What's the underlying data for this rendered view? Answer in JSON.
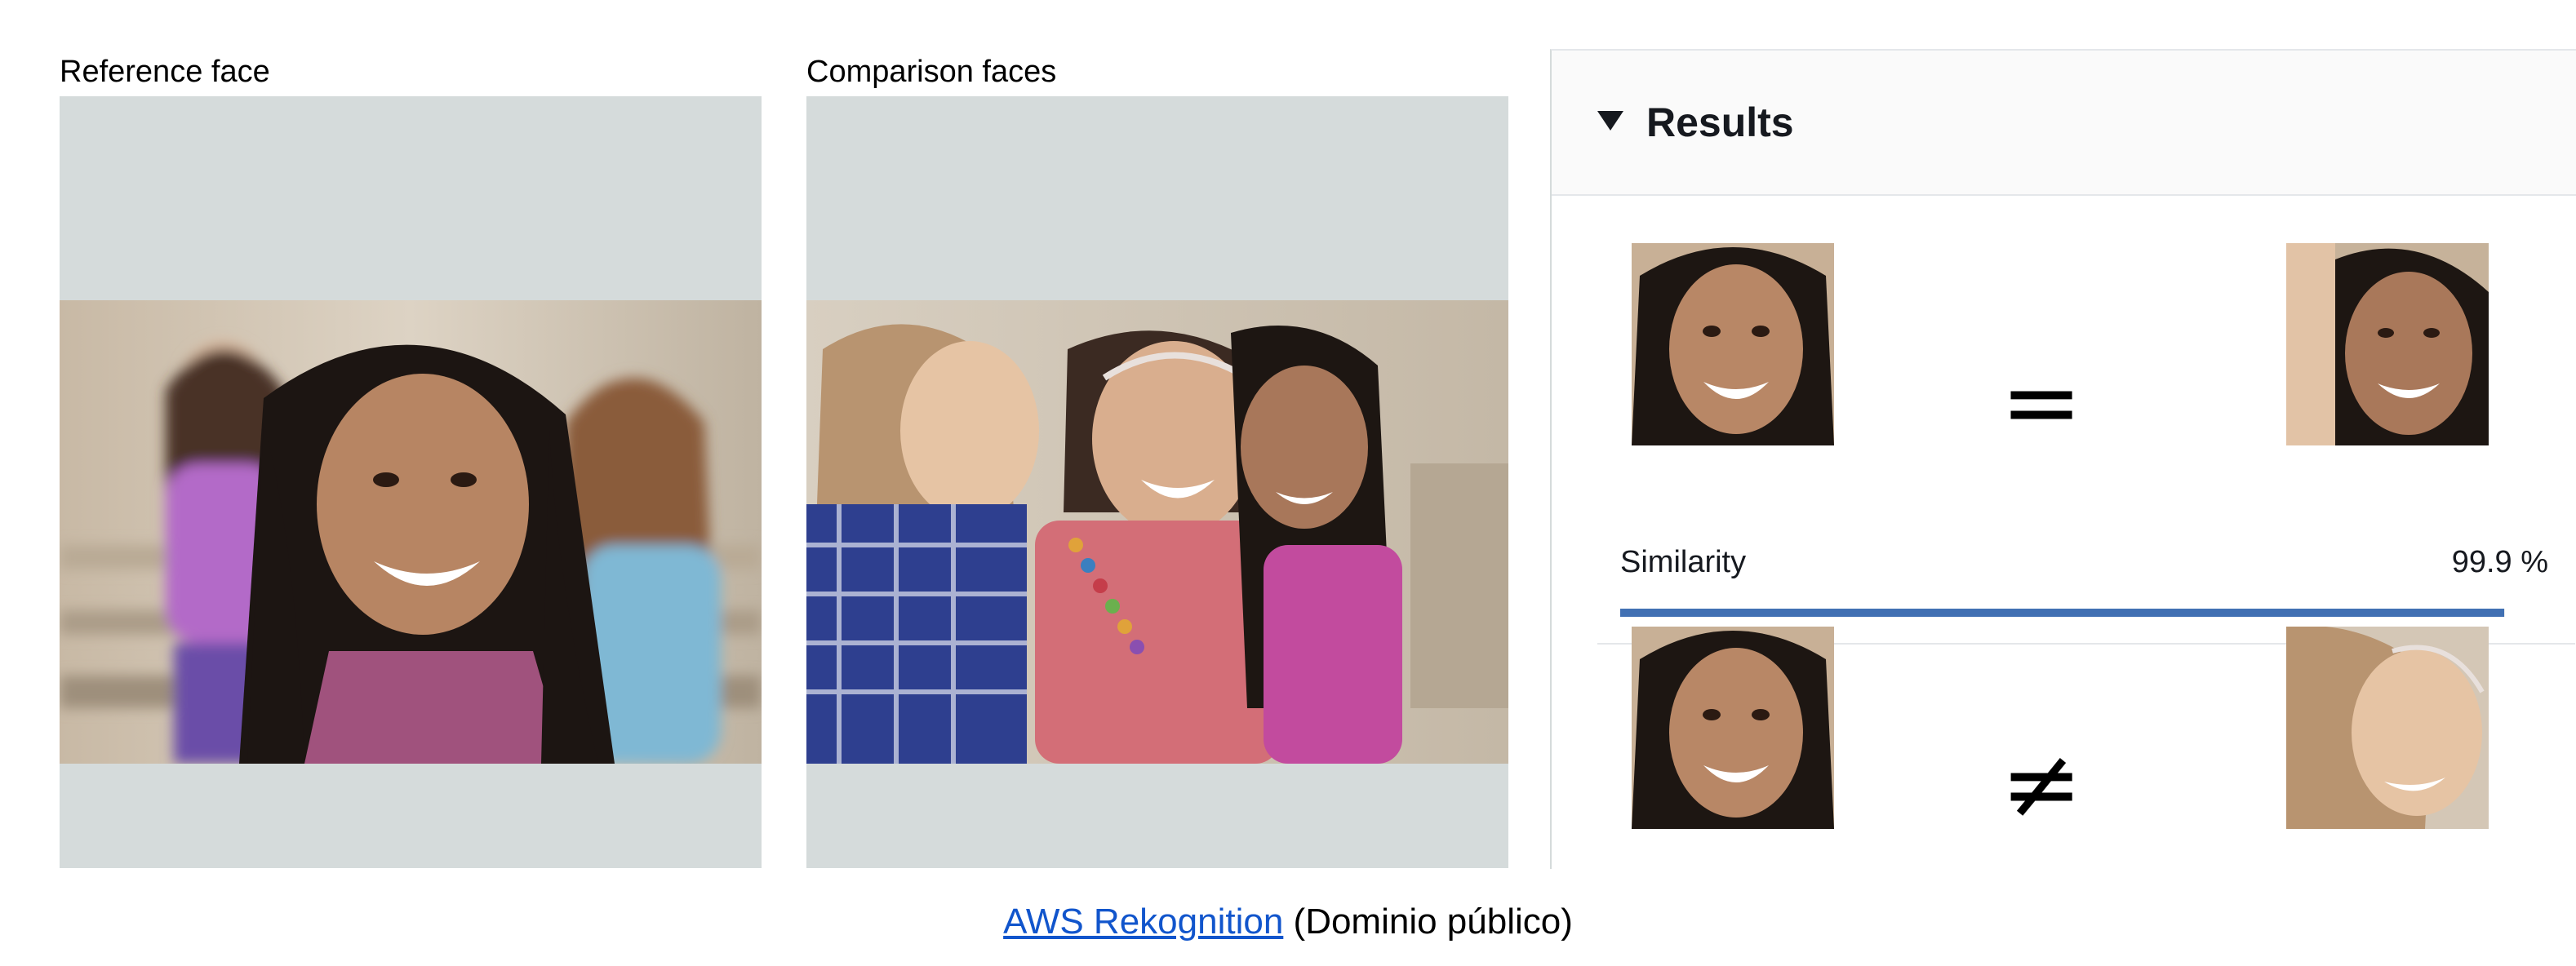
{
  "reference": {
    "label": "Reference face"
  },
  "comparison": {
    "label": "Comparison faces"
  },
  "results": {
    "title": "Results",
    "matches": [
      {
        "symbol": "=",
        "similarity_label": "Similarity",
        "similarity_value": "99.9 %",
        "similarity_fraction": 0.999
      },
      {
        "symbol": "≠"
      }
    ]
  },
  "caption": {
    "link_text": "AWS Rekognition",
    "suffix": " (Dominio público)"
  },
  "colors": {
    "frame_background": "#d5dbdb",
    "progress_fill": "#4170b3",
    "link": "#1155cc"
  }
}
